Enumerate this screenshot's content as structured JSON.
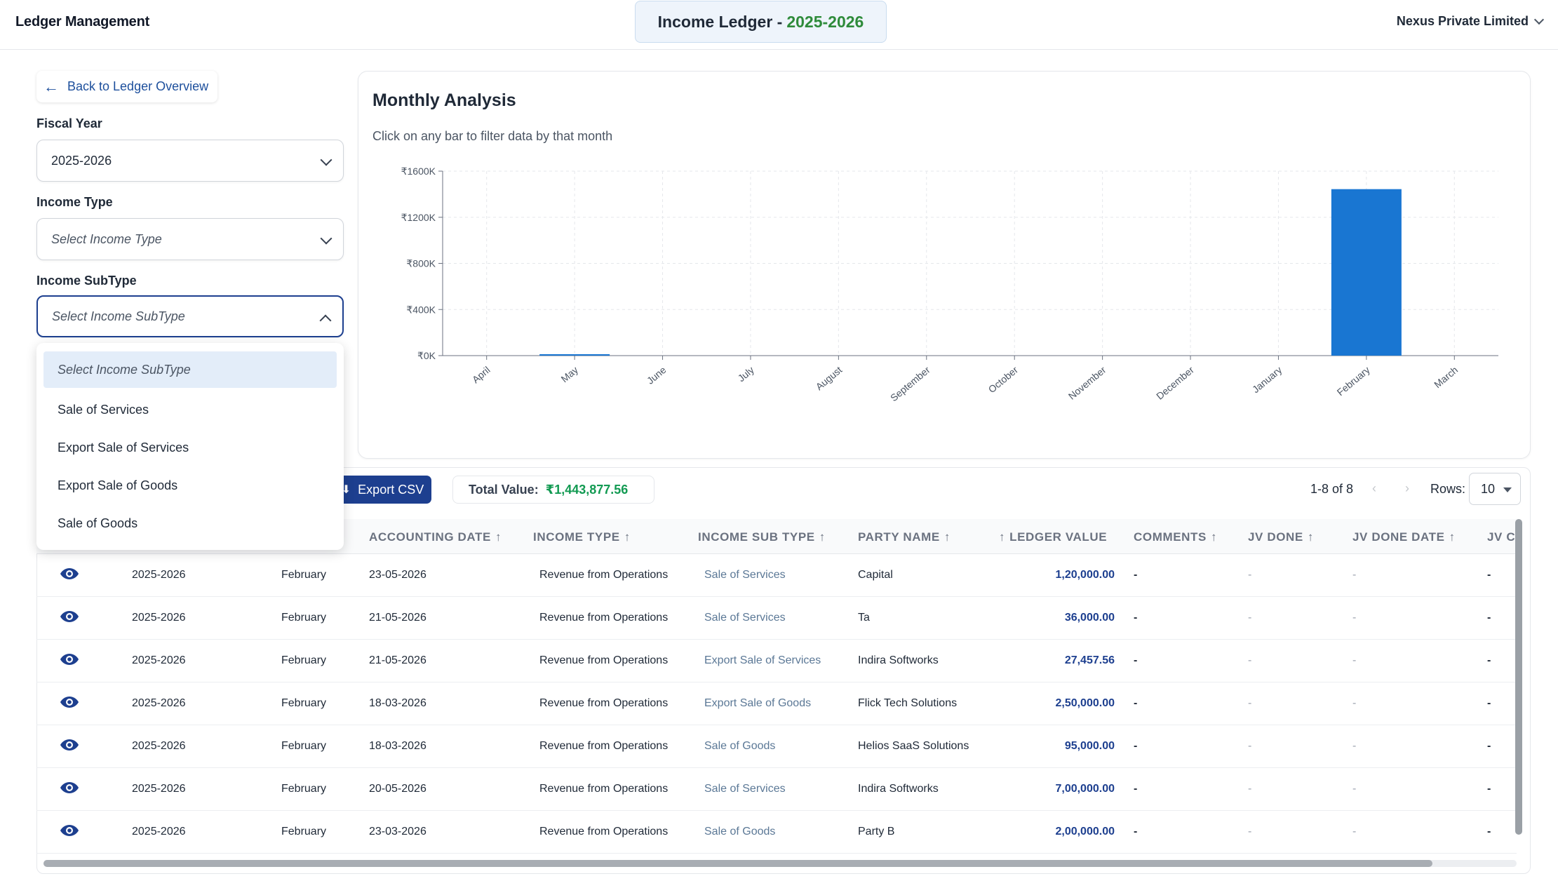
{
  "header": {
    "brand": "Ledger Management",
    "title_prefix": "Income Ledger - ",
    "title_year": "2025-2026",
    "company": "Nexus Private Limited"
  },
  "sidebar": {
    "back_label": "Back to Ledger Overview",
    "fiscal_year_label": "Fiscal Year",
    "fiscal_year_value": "2025-2026",
    "income_type_label": "Income Type",
    "income_type_placeholder": "Select Income Type",
    "income_subtype_label": "Income SubType",
    "income_subtype_placeholder": "Select Income SubType",
    "subtype_options": [
      "Select Income SubType",
      "Sale of Services",
      "Export Sale of Services",
      "Export Sale of Goods",
      "Sale of Goods"
    ]
  },
  "chart": {
    "title": "Monthly Analysis",
    "subtitle": "Click on any bar to filter data by that month"
  },
  "chart_data": {
    "type": "bar",
    "categories": [
      "April",
      "May",
      "June",
      "July",
      "August",
      "September",
      "October",
      "November",
      "December",
      "January",
      "February",
      "March"
    ],
    "values": [
      0,
      12000,
      0,
      0,
      0,
      0,
      0,
      0,
      0,
      0,
      1443877.56,
      0
    ],
    "ylim": [
      0,
      1600000
    ],
    "yticks": [
      "₹0K",
      "₹400K",
      "₹800K",
      "₹1200K",
      "₹1600K"
    ],
    "grid": true,
    "bar_color": "#1976d2"
  },
  "toolbar": {
    "export_label": "Export CSV",
    "total_label": "Total Value:",
    "total_value": "₹1,443,877.56",
    "page_info": "1-8 of 8",
    "prev_glyph": "‹",
    "next_glyph": "›",
    "rows_label": "Rows:",
    "rows_value": "10"
  },
  "table": {
    "headers": [
      "ACCOUNTING DATE",
      "INCOME TYPE",
      "INCOME SUB TYPE",
      "PARTY NAME",
      "LEDGER VALUE",
      "COMMENTS",
      "JV DONE",
      "JV DONE DATE",
      "JV C"
    ],
    "sort_glyph": "↑",
    "rows": [
      {
        "fy": "2025-2026",
        "month": "February",
        "date": "23-05-2026",
        "type": "Revenue from Operations",
        "subtype": "Sale of Services",
        "party": "Capital",
        "value": "1,20,000.00",
        "comments": "-",
        "jv_done": "-",
        "jv_date": "-",
        "jv_c": "-"
      },
      {
        "fy": "2025-2026",
        "month": "February",
        "date": "21-05-2026",
        "type": "Revenue from Operations",
        "subtype": "Sale of Services",
        "party": "Ta",
        "value": "36,000.00",
        "comments": "-",
        "jv_done": "-",
        "jv_date": "-",
        "jv_c": "-"
      },
      {
        "fy": "2025-2026",
        "month": "February",
        "date": "21-05-2026",
        "type": "Revenue from Operations",
        "subtype": "Export Sale of Services",
        "party": "Indira Softworks",
        "value": "27,457.56",
        "comments": "-",
        "jv_done": "-",
        "jv_date": "-",
        "jv_c": "-"
      },
      {
        "fy": "2025-2026",
        "month": "February",
        "date": "18-03-2026",
        "type": "Revenue from Operations",
        "subtype": "Export Sale of Goods",
        "party": "Flick Tech Solutions",
        "value": "2,50,000.00",
        "comments": "-",
        "jv_done": "-",
        "jv_date": "-",
        "jv_c": "-"
      },
      {
        "fy": "2025-2026",
        "month": "February",
        "date": "18-03-2026",
        "type": "Revenue from Operations",
        "subtype": "Sale of Goods",
        "party": "Helios SaaS Solutions",
        "value": "95,000.00",
        "comments": "-",
        "jv_done": "-",
        "jv_date": "-",
        "jv_c": "-"
      },
      {
        "fy": "2025-2026",
        "month": "February",
        "date": "20-05-2026",
        "type": "Revenue from Operations",
        "subtype": "Sale of Services",
        "party": "Indira Softworks",
        "value": "7,00,000.00",
        "comments": "-",
        "jv_done": "-",
        "jv_date": "-",
        "jv_c": "-"
      },
      {
        "fy": "2025-2026",
        "month": "February",
        "date": "23-03-2026",
        "type": "Revenue from Operations",
        "subtype": "Sale of Goods",
        "party": "Party B",
        "value": "2,00,000.00",
        "comments": "-",
        "jv_done": "-",
        "jv_date": "-",
        "jv_c": "-"
      }
    ]
  }
}
